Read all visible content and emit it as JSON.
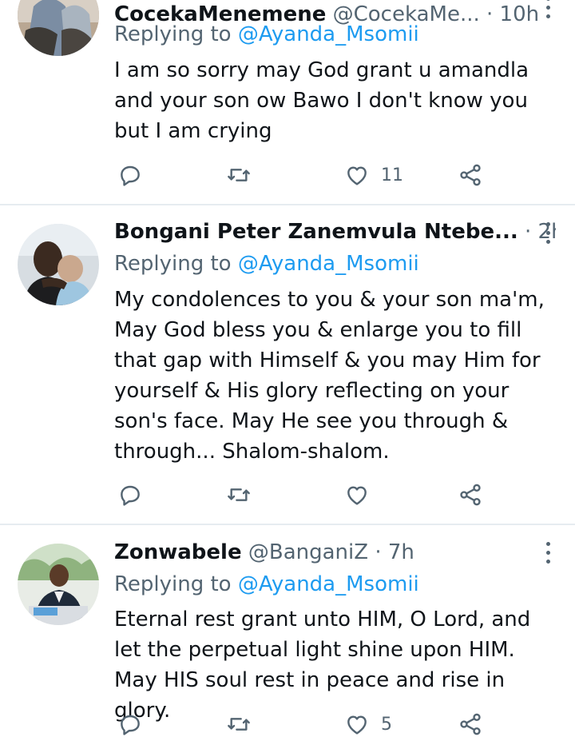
{
  "tweets": [
    {
      "name": "CocekaMenemene",
      "handle": "@CocekaMe...",
      "separator": "·",
      "time": "10h",
      "reply_prefix": "Replying to",
      "reply_to": "@Ayanda_Msomii",
      "text": "I am so sorry may God grant u amandla and your son ow Bawo I don't know you but I am crying",
      "like_count": "11"
    },
    {
      "name": "Bongani Peter Zanemvula Ntebe...",
      "handle": "",
      "separator": "·",
      "time": "2h",
      "reply_prefix": "Replying to",
      "reply_to": "@Ayanda_Msomii",
      "text": "My condolences to you & your son ma'm, May God bless you & enlarge you to fill that gap with Himself & you may Him for yourself & His glory reflecting on your son's face. May He see you through & through... Shalom-shalom.",
      "like_count": ""
    },
    {
      "name": "Zonwabele",
      "handle": "@BanganiZ",
      "separator": "·",
      "time": "7h",
      "reply_prefix": "Replying to",
      "reply_to": "@Ayanda_Msomii",
      "text": "Eternal rest grant unto HIM, O Lord, and let the perpetual light shine upon HIM. May HIS soul rest in peace and rise in glory.",
      "like_count": "5"
    }
  ],
  "icons": {
    "reply": "reply-icon",
    "retweet": "retweet-icon",
    "like": "heart-icon",
    "share": "share-icon",
    "more": "more-options-icon"
  },
  "colors": {
    "link": "#1d9bf0",
    "muted": "#536471",
    "text": "#0f1419",
    "divider": "#e6ecf0"
  }
}
